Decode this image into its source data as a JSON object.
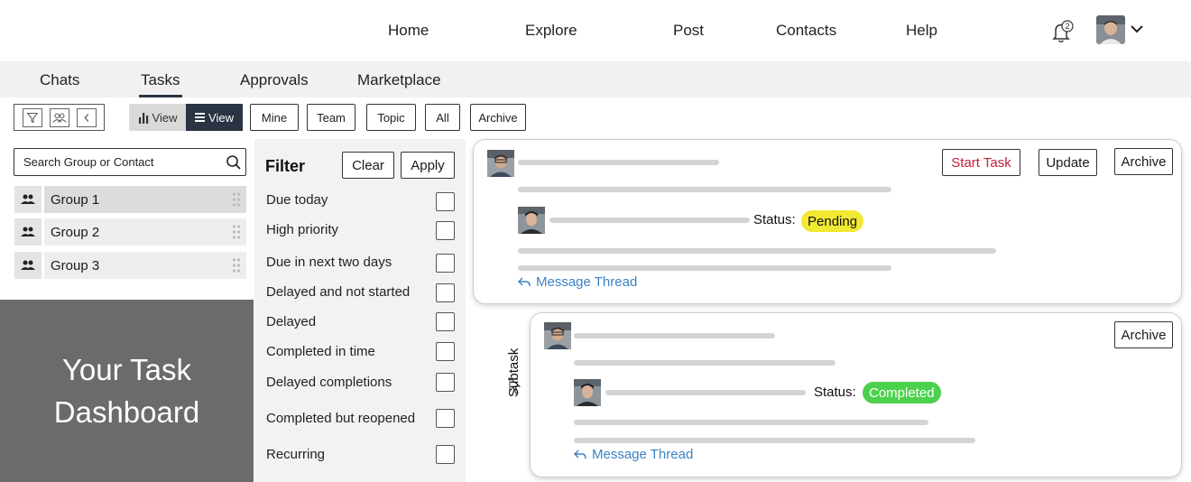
{
  "nav": {
    "links": [
      "Home",
      "Explore",
      "Post",
      "Contacts",
      "Help"
    ],
    "notification_count": "2",
    "icons": {
      "bell": "bell-icon",
      "avatar": "user-avatar",
      "menu": "chevron-down-icon"
    }
  },
  "subtabs": {
    "items": [
      "Chats",
      "Tasks",
      "Approvals",
      "Marketplace"
    ],
    "active": "Tasks"
  },
  "toolbar": {
    "icons": [
      "filter-icon",
      "group-icon",
      "collapse-icon"
    ],
    "view_chart_label": "View",
    "view_list_label": "View",
    "chips": [
      "Mine",
      "Team",
      "Topic",
      "All",
      "Archive"
    ]
  },
  "sidebar": {
    "search_placeholder": "Search Group or Contact",
    "groups": [
      "Group 1",
      "Group 2",
      "Group 3"
    ],
    "dashboard_title": "Your Task Dashboard"
  },
  "filter": {
    "title": "Filter",
    "clear_label": "Clear",
    "apply_label": "Apply",
    "options": [
      "Due today",
      "High priority",
      "Due in next two days",
      "Delayed and not started",
      "Delayed",
      "Completed in time",
      "Delayed completions",
      "Completed but reopened",
      "Recurring"
    ]
  },
  "tasks": [
    {
      "buttons": [
        "Start Task",
        "Update",
        "Archive"
      ],
      "status_label": "Status:",
      "status": "Pending",
      "status_color": "#f2e933",
      "thread_label": "Message Thread"
    },
    {
      "subtask_label": "Subtask",
      "buttons": [
        "Archive"
      ],
      "status_label": "Status:",
      "status": "Completed",
      "status_color": "#4cd14c",
      "thread_label": "Message Thread"
    }
  ],
  "colors": {
    "accent_dark": "#2a3442",
    "start_task": "#c0213b",
    "link": "#3b82c4",
    "dashboard_bg": "#6b6b6b"
  }
}
